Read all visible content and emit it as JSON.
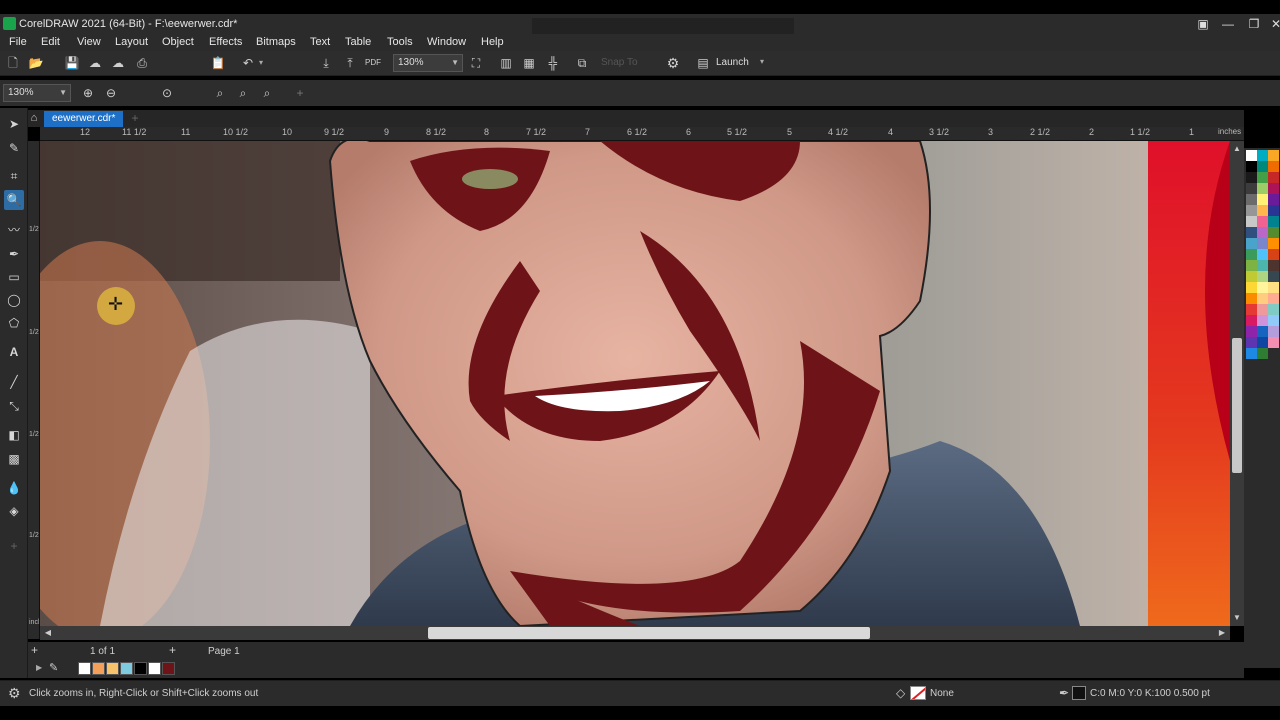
{
  "window": {
    "title": "CorelDRAW 2021 (64-Bit) - F:\\eewerwer.cdr*",
    "minimize_icon": "minimize-icon",
    "maximize_icon": "maximize-icon",
    "close_icon": "close-icon"
  },
  "menu": {
    "items": [
      "File",
      "Edit",
      "View",
      "Layout",
      "Object",
      "Effects",
      "Bitmaps",
      "Text",
      "Table",
      "Tools",
      "Window",
      "Help"
    ]
  },
  "toolbar": {
    "zoom_value": "130%",
    "snap_to_label": "Snap To",
    "launch_label": "Launch"
  },
  "property_bar": {
    "zoom_value": "130%"
  },
  "document": {
    "tab_label": "eewerwer.cdr*",
    "ruler_units": "inches",
    "ruler_labels": [
      "12",
      "11 1/2",
      "11",
      "10 1/2",
      "10",
      "9 1/2",
      "9",
      "8 1/2",
      "8",
      "7 1/2",
      "7",
      "6 1/2",
      "6",
      "5 1/2",
      "5",
      "4 1/2",
      "4",
      "3 1/2",
      "3",
      "2 1/2",
      "2",
      "1 1/2",
      "1"
    ],
    "vruler_labels": [
      "1/2",
      "1/2",
      "1/2",
      "1/2",
      "1/2"
    ]
  },
  "pages": {
    "counter": "1 of 1",
    "page_tab": "Page 1"
  },
  "status": {
    "hint": "Click zooms in, Right-Click or Shift+Click zooms out",
    "fill_label": "None",
    "outline_label": "C:0 M:0 Y:0 K:100  0.500 pt"
  },
  "colors": {
    "accent": "#1e6fc6",
    "artwork_maroon": "#6e1418",
    "artwork_red": "#d0102a"
  },
  "palette_colors": [
    "#ffffff",
    "#000000",
    "#1a1a1a",
    "#3c3c3c",
    "#6b6b6b",
    "#969696",
    "#c8c8c8",
    "#2f4f7f",
    "#4aa3c8",
    "#3a9b5a",
    "#7cb342",
    "#c0ca33",
    "#fdd835",
    "#fb8c00",
    "#e53935",
    "#d81b60",
    "#8e24aa",
    "#5e35b1",
    "#1e88e5",
    "#00acc1",
    "#00897b",
    "#43a047",
    "#9ccc65",
    "#fff176",
    "#ffb74d",
    "#f06292",
    "#ba68c8",
    "#7986cb",
    "#4fc3f7",
    "#4db6ac",
    "#aed581",
    "#fff59d",
    "#ffcc80",
    "#ef9a9a",
    "#ce93d8",
    "#1565c0",
    "#0d47a1",
    "#2e7d32",
    "#f9a825",
    "#ef6c00",
    "#c62828",
    "#ad1457",
    "#6a1b9a",
    "#283593",
    "#00838f",
    "#558b2f",
    "#ff8f00",
    "#d84315",
    "#4e342e",
    "#37474f",
    "#ffe082",
    "#ffab91",
    "#80cbc4",
    "#90caf9",
    "#b39ddb",
    "#f48fb1"
  ],
  "doc_palette": [
    "#ffffff",
    "#f4a05a",
    "#f6c26b",
    "#7ecbe0",
    "#000000",
    "#ffffff",
    "#6e1418"
  ]
}
